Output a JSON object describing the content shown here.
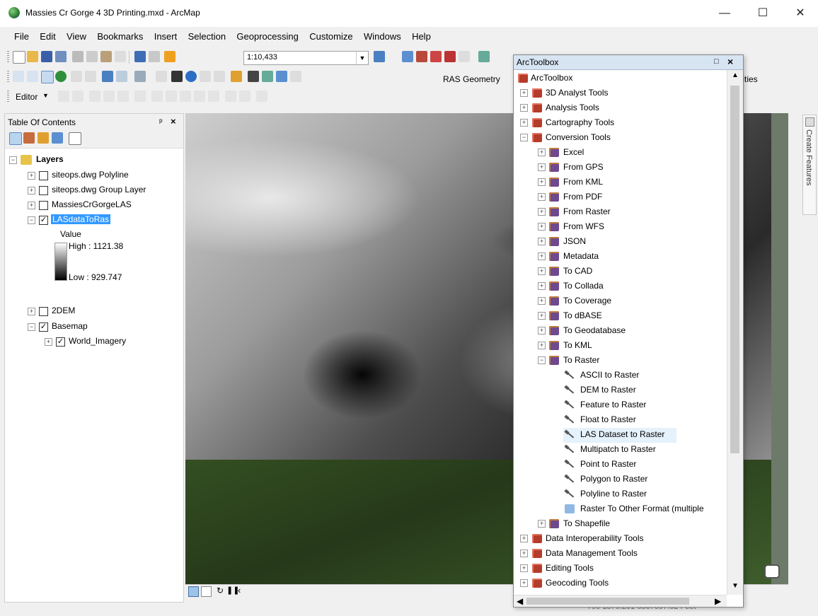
{
  "window": {
    "title": "Massies Cr Gorge 4 3D Printing.mxd - ArcMap"
  },
  "menu": [
    "File",
    "Edit",
    "View",
    "Bookmarks",
    "Insert",
    "Selection",
    "Geoprocessing",
    "Customize",
    "Windows",
    "Help"
  ],
  "toolbar": {
    "scale": "1:10,433",
    "ras_geometry": "RAS Geometry",
    "utilities": "ilities",
    "editor": "Editor"
  },
  "toc": {
    "title": "Table Of Contents",
    "root": "Layers",
    "layers": [
      "siteops.dwg Polyline",
      "siteops.dwg Group Layer",
      "MassiesCrGorgeLAS",
      "LASdataToRas",
      "2DEM",
      "Basemap",
      "World_Imagery"
    ],
    "legend": {
      "field": "Value",
      "high": "High : 1121.38",
      "low": "Low : 929.747"
    }
  },
  "toolbox": {
    "title": "ArcToolbox",
    "root": "ArcToolbox",
    "items": [
      "3D Analyst Tools",
      "Analysis Tools",
      "Cartography Tools",
      "Conversion Tools",
      "Excel",
      "From GPS",
      "From KML",
      "From PDF",
      "From Raster",
      "From WFS",
      "JSON",
      "Metadata",
      "To CAD",
      "To Collada",
      "To Coverage",
      "To dBASE",
      "To Geodatabase",
      "To KML",
      "To Raster",
      "ASCII to Raster",
      "DEM to Raster",
      "Feature to Raster",
      "Float to Raster",
      "LAS Dataset to Raster",
      "Multipatch to Raster",
      "Point to Raster",
      "Polygon to Raster",
      "Polyline to Raster",
      "Raster To Other Format (multiple",
      "To Shapefile",
      "Data Interoperability Tools",
      "Data Management Tools",
      "Editing Tools",
      "Geocoding Tools"
    ]
  },
  "side_tab": "Create Features",
  "status": {
    "coords": "799 1379.201   6567097.02 Feet"
  }
}
